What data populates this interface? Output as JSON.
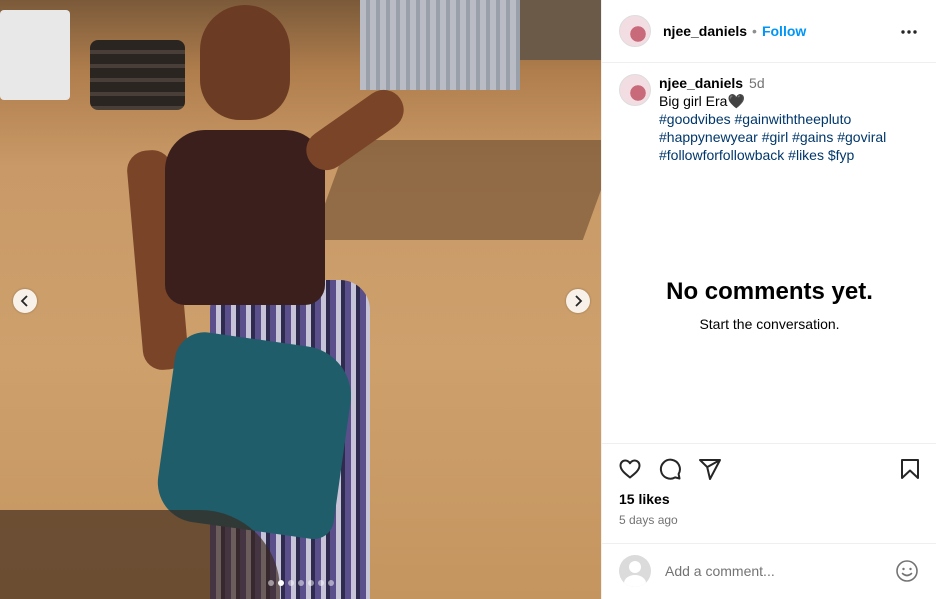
{
  "post": {
    "username": "njee_daniels",
    "follow_label": "Follow",
    "separator": "•",
    "media": {
      "slide_count": 7,
      "active_slide_index": 1
    }
  },
  "caption": {
    "username": "njee_daniels",
    "time": "5d",
    "line1": "Big girl Era🖤",
    "hashtags": "#goodvibes #gainwiththeepluto #happynewyear #girl #gains #goviral #followforfollowback #likes $fyp"
  },
  "comments": {
    "empty_title": "No comments yet.",
    "empty_subtitle": "Start the conversation."
  },
  "actions": {
    "like_icon": "heart-icon",
    "comment_icon": "comment-icon",
    "share_icon": "share-icon",
    "save_icon": "bookmark-icon"
  },
  "stats": {
    "likes": "15 likes",
    "posted": "5 days ago"
  },
  "comment_box": {
    "placeholder": "Add a comment...",
    "emoji_icon": "emoji-icon"
  },
  "colors": {
    "accent": "#0095f6",
    "hashtag": "#00376b",
    "muted": "#737373",
    "divider": "#efefef"
  }
}
